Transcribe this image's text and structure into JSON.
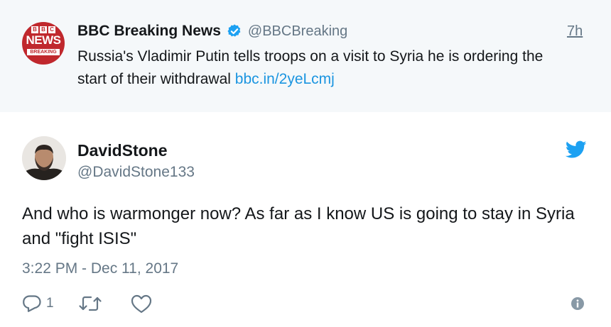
{
  "quoted_tweet": {
    "logo": {
      "blocks": [
        "B",
        "B",
        "C"
      ],
      "word": "NEWS",
      "strap": "BREAKING"
    },
    "name": "BBC Breaking News",
    "handle": "@BBCBreaking",
    "time": "7h",
    "text": "Russia's Vladimir Putin tells troops on a visit to Syria he is ordering the start of their withdrawal",
    "link": "bbc.in/2yeLcmj"
  },
  "tweet": {
    "author_name": "DavidStone",
    "author_handle": "@DavidStone133",
    "text": "And who is warmonger now? As far as I know US is going to stay in Syria and \"fight ISIS\"",
    "timestamp": "3:22 PM - Dec 11, 2017"
  },
  "actions": {
    "reply_count": "1",
    "retweet_count": "",
    "like_count": ""
  },
  "icons": {
    "verified": "verified-badge-icon",
    "brand": "twitter-bird-icon",
    "reply": "reply-icon",
    "retweet": "retweet-icon",
    "like": "heart-icon",
    "info": "info-icon"
  },
  "colors": {
    "accent": "#1da1f2",
    "link": "#1b95e0",
    "muted": "#657786",
    "quote_bg": "#f5f8fa",
    "bbc_red": "#c0282d"
  }
}
